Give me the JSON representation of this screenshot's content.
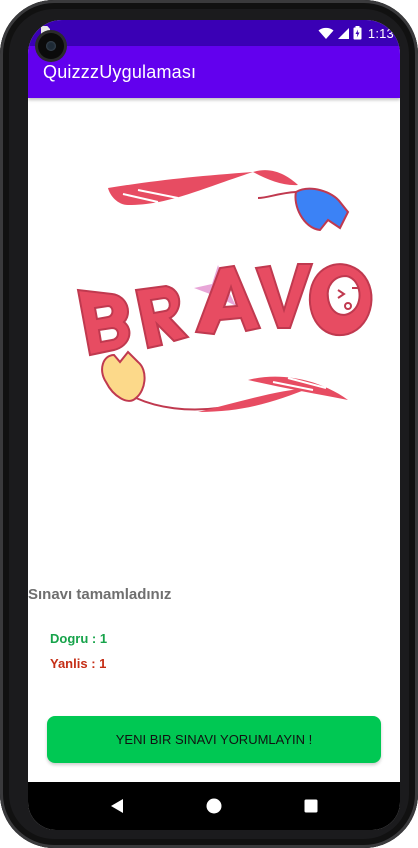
{
  "status_bar": {
    "time": "1:13",
    "icons": [
      "sd-card-icon",
      "wifi-icon",
      "signal-icon",
      "battery-icon"
    ],
    "background": "#3a00b5"
  },
  "app_bar": {
    "title": "QuizzzUygulaması",
    "background": "#6200ee"
  },
  "result_image": {
    "word": "BRAVO",
    "colors": {
      "letters": "#e74c62",
      "blue_flower": "#3b82f6",
      "yellow_flower": "#fcd98a",
      "sparkle": "#e8a6d8"
    }
  },
  "result": {
    "completed_text": "Sınavı tamamladınız",
    "correct_label": "Dogru  : 1",
    "wrong_label": "Yanlis : 1",
    "correct_color": "#16a34a",
    "wrong_color": "#c52e16"
  },
  "actions": {
    "new_quiz_label": "YENI BIR SINAVI YORUMLAYIN !",
    "button_color": "#00c853"
  },
  "nav_bar": {
    "buttons": [
      "back-icon",
      "home-icon",
      "recents-icon"
    ]
  }
}
